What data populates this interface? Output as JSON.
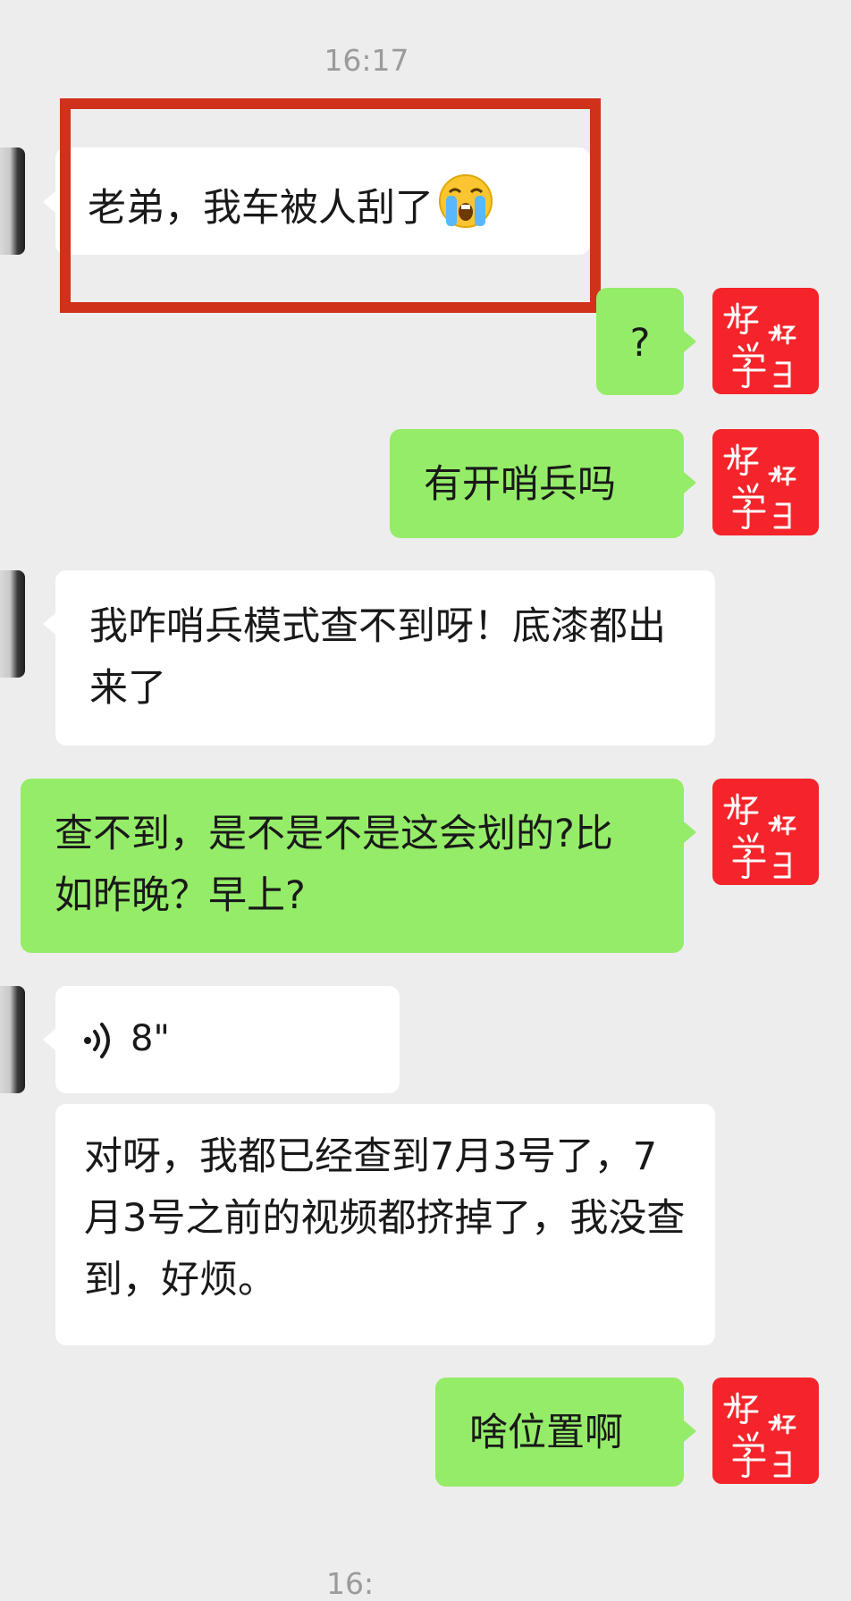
{
  "timestamps": {
    "top": "16:17",
    "bottom": "16:"
  },
  "messages": [
    {
      "side": "left",
      "text": "老弟，我车被人刮了",
      "emoji": "loudly-crying-face"
    },
    {
      "side": "right",
      "text": "?"
    },
    {
      "side": "right",
      "text": "有开哨兵吗"
    },
    {
      "side": "left",
      "text": "我咋哨兵模式查不到呀！底漆都出来了"
    },
    {
      "side": "right",
      "text": "查不到，是不是不是这会划的?比如昨晚？早上?"
    },
    {
      "side": "left",
      "type": "voice",
      "duration": "8\""
    },
    {
      "side": "left",
      "text": "对呀，我都已经查到7月3号了，7月3号之前的视频都挤掉了，我没查到，好烦。"
    },
    {
      "side": "right",
      "text": "啥位置啊"
    }
  ],
  "colors": {
    "background": "#ededed",
    "incoming_bubble": "#ffffff",
    "outgoing_bubble": "#95ec69",
    "highlight_box": "#d0311b",
    "self_avatar": "#f4242a"
  },
  "self_avatar_art": {
    "line1": "好",
    "line2": "好",
    "line3": "学",
    "line4": "习"
  }
}
